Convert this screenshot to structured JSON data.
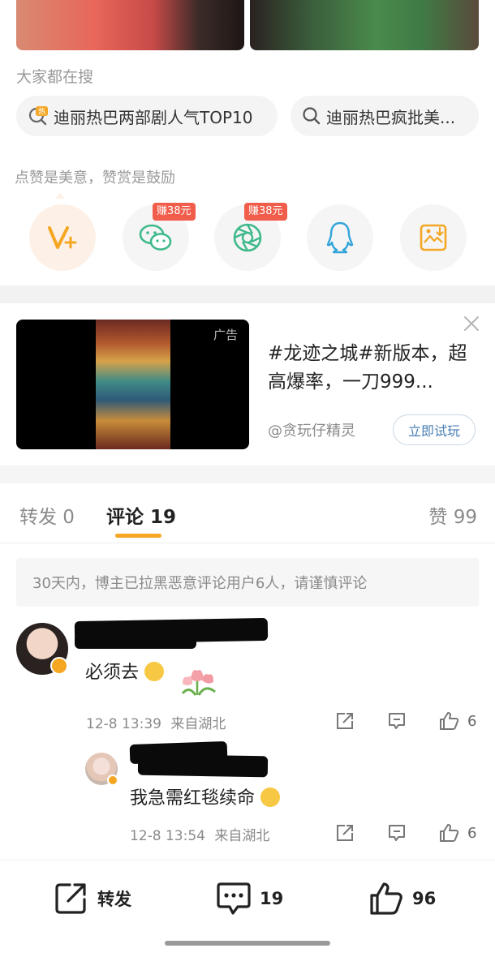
{
  "search_section": {
    "label": "大家都在搜",
    "items": [
      {
        "text": "迪丽热巴两部剧人气TOP10",
        "icon": "hot-search-icon",
        "badge": "热"
      },
      {
        "text": "迪丽热巴疯批美...",
        "icon": "search-icon"
      }
    ]
  },
  "reward_section": {
    "label": "点赞是美意，赞赏是鼓励",
    "buttons": [
      {
        "name": "weibo-v-plus",
        "icon": "v-plus-icon",
        "color": "#f5a623"
      },
      {
        "name": "wechat",
        "icon": "wechat-icon",
        "badge": "赚38元",
        "color": "#3fb98a"
      },
      {
        "name": "moments",
        "icon": "moments-icon",
        "badge": "赚38元",
        "color": "#3fb98a"
      },
      {
        "name": "qq",
        "icon": "qq-icon",
        "color": "#32a4d9"
      },
      {
        "name": "save-image",
        "icon": "image-download-icon",
        "color": "#f5a623"
      }
    ]
  },
  "ad": {
    "tag": "广告",
    "title": "#龙迹之城#新版本，超高爆率，一刀999...",
    "author": "@贪玩仔精灵",
    "cta": "立即试玩"
  },
  "tabs": {
    "repost": "转发 0",
    "comments": "评论 19",
    "likes": "赞 99"
  },
  "notice": "30天内，博主已拉黑恶意评论用户6人，请谨慎评论",
  "comments": [
    {
      "text": "必须去",
      "emoji": "crying-face-icon",
      "sticker": "tulip-sticker",
      "time": "12-8 13:39",
      "location": "来自湖北",
      "likes": "6"
    },
    {
      "text": "我急需红毯续命",
      "emoji": "crying-face-icon",
      "time": "12-8 13:54",
      "location": "来自湖北",
      "likes": "6"
    }
  ],
  "bottom_bar": {
    "repost": "转发",
    "comments": "19",
    "likes": "96"
  },
  "colors": {
    "accent": "#f5a623",
    "badge": "#f15d4b",
    "link": "#4a7fb5"
  }
}
